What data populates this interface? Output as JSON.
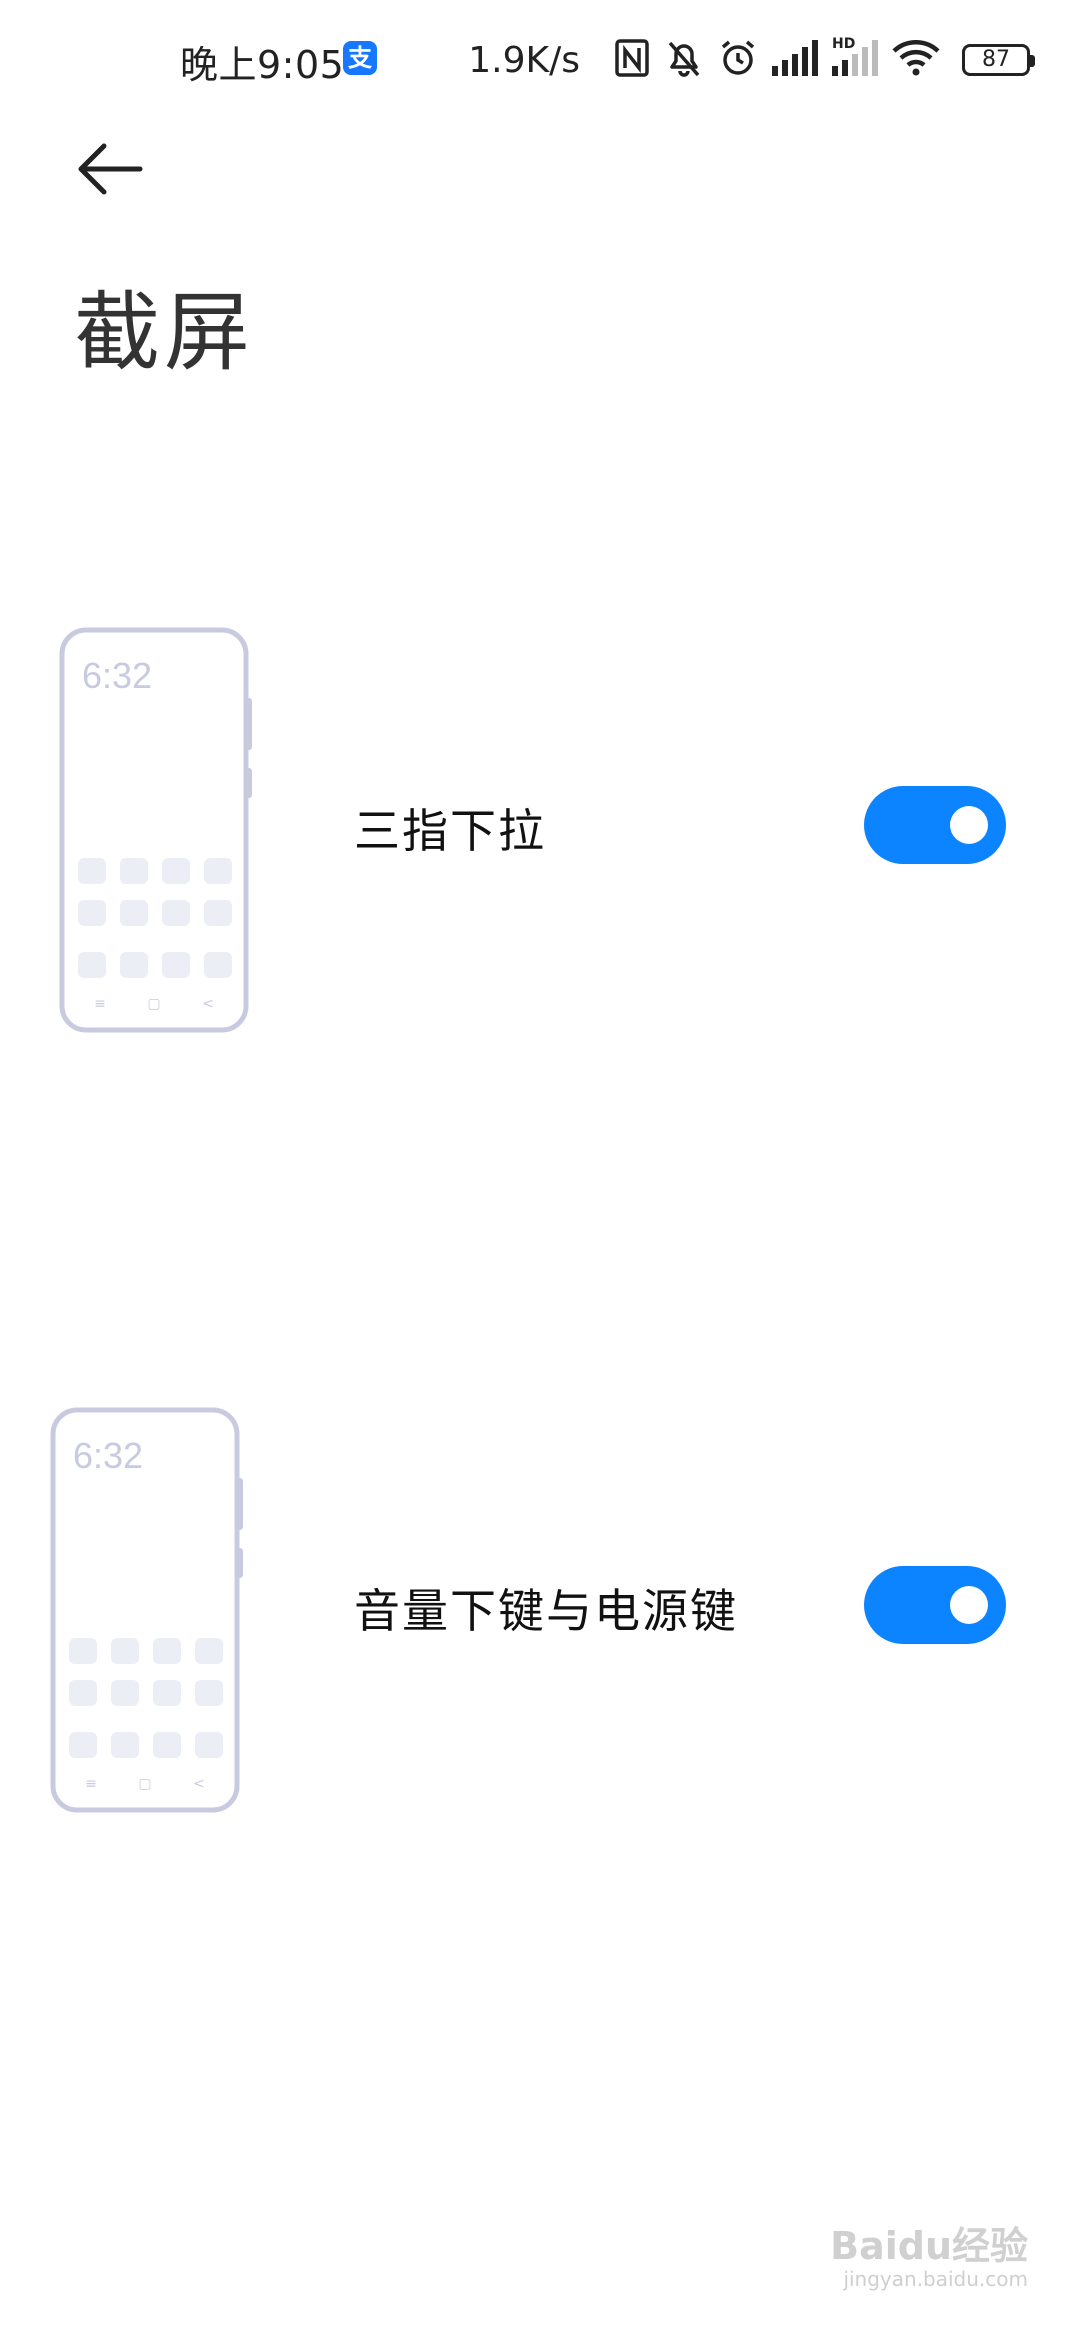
{
  "status_bar": {
    "time": "晚上9:05",
    "app_badge_char": "支",
    "net_speed": "1.9K/s",
    "battery": "87",
    "hd_label": "HD",
    "icons": [
      "alipay-icon",
      "nfc-icon",
      "mute-bell-icon",
      "alarm-icon",
      "signal-icon",
      "signal-hd-icon",
      "wifi-icon",
      "battery-icon"
    ]
  },
  "header": {
    "back_icon": "arrow-left-icon",
    "title": "截屏"
  },
  "settings": [
    {
      "label": "三指下拉",
      "enabled": true,
      "illustration_time": "6:32"
    },
    {
      "label": "音量下键与电源键",
      "enabled": true,
      "illustration_time": "6:32"
    }
  ],
  "illustration_nav": {
    "menu": "≡",
    "home": "▢",
    "back": "<"
  },
  "colors": {
    "accent": "#0d84ff",
    "illustration_outline": "#c8cbe0",
    "illustration_icon": "#eceef6",
    "illustration_time": "#c8cbe0"
  },
  "watermark": {
    "brand": "Baidu经验",
    "url": "jingyan.baidu.com"
  }
}
